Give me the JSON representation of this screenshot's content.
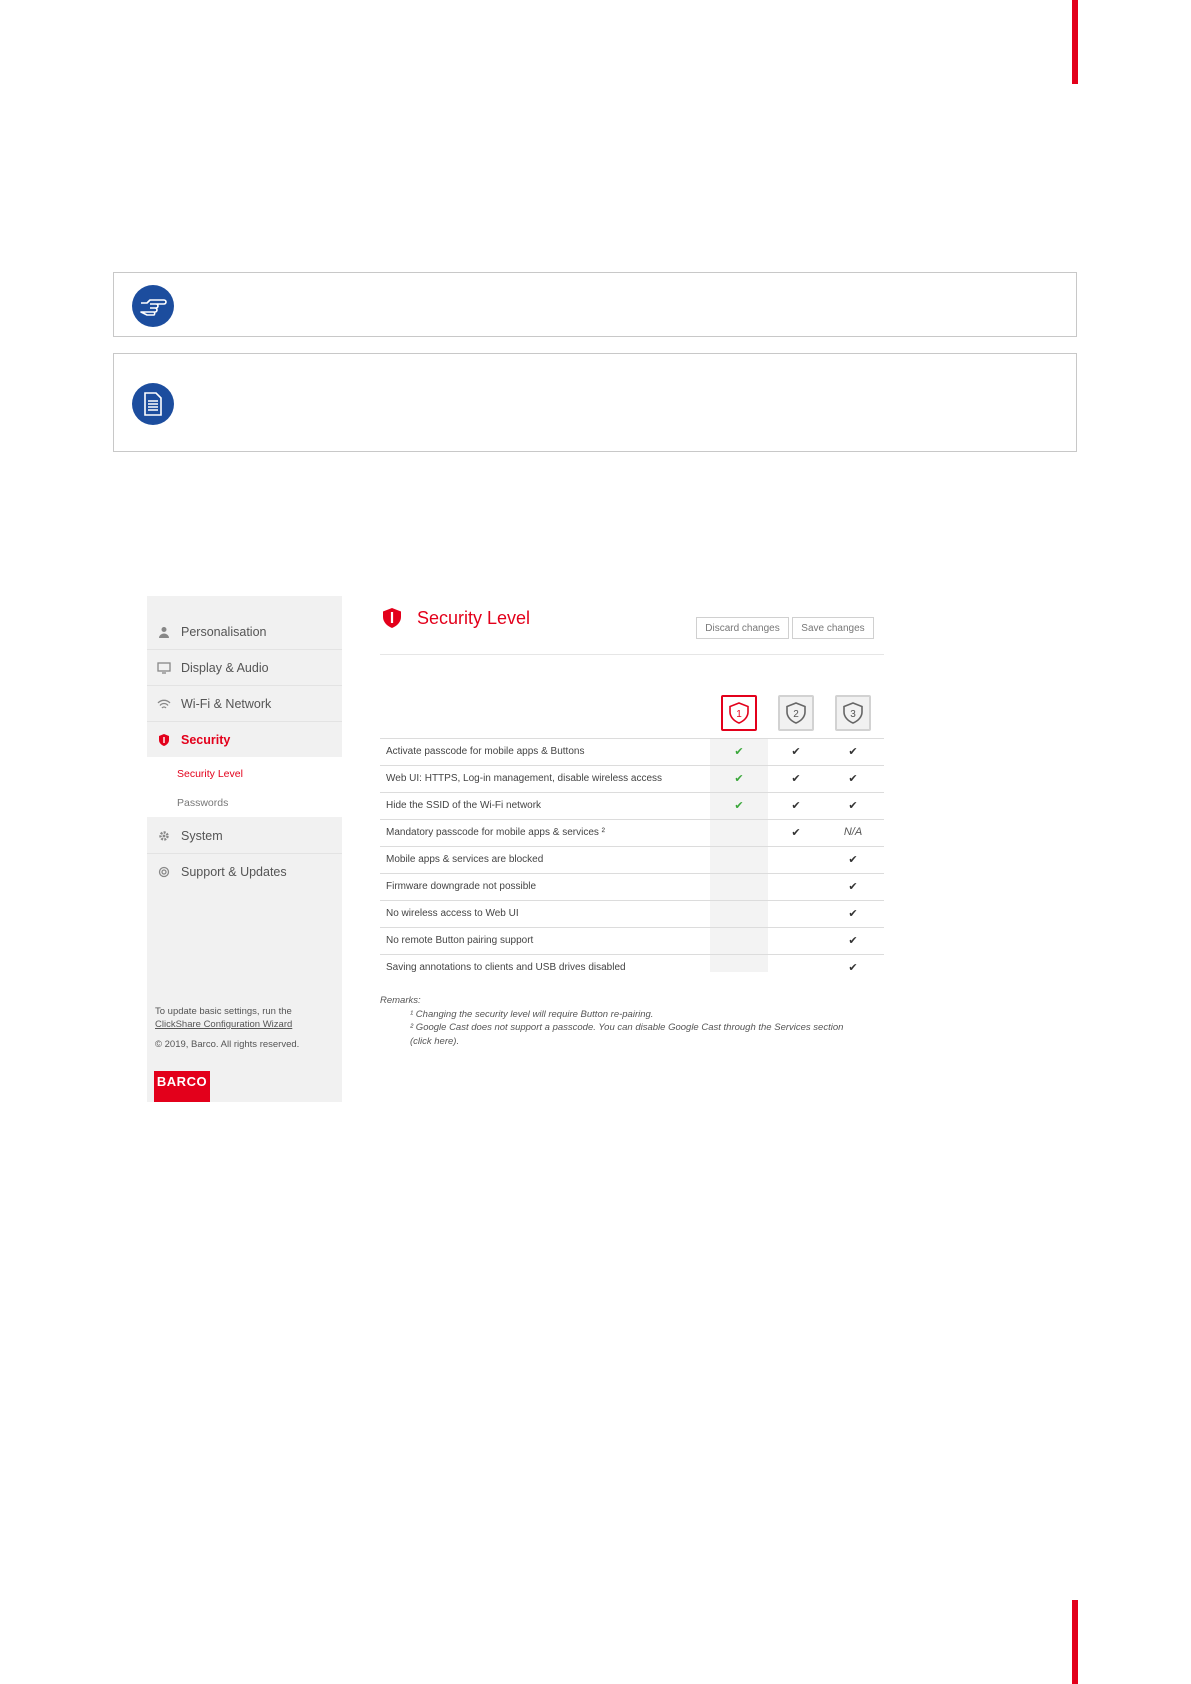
{
  "sidebar": {
    "items": [
      {
        "label": "Personalisation",
        "icon": "user-icon"
      },
      {
        "label": "Display & Audio",
        "icon": "monitor-icon"
      },
      {
        "label": "Wi-Fi & Network",
        "icon": "wifi-icon"
      },
      {
        "label": "Security",
        "icon": "shield-icon"
      },
      {
        "label": "System",
        "icon": "gear-icon"
      },
      {
        "label": "Support & Updates",
        "icon": "lifebuoy-icon"
      }
    ],
    "sub_items": [
      "Security Level",
      "Passwords"
    ],
    "footer_line1": "To update basic settings, run the",
    "footer_link": "ClickShare Configuration Wizard",
    "copyright": "© 2019, Barco. All rights reserved.",
    "logo": "BARCO"
  },
  "main": {
    "title": "Security Level",
    "discard_label": "Discard changes",
    "save_label": "Save changes",
    "levels": [
      "1",
      "2",
      "3"
    ],
    "selected_level": "1",
    "rows": [
      {
        "label": "Activate passcode for mobile apps & Buttons",
        "l1": "✔",
        "l2": "✔",
        "l3": "✔"
      },
      {
        "label": "Web UI: HTTPS, Log-in management, disable wireless access",
        "l1": "✔",
        "l2": "✔",
        "l3": "✔"
      },
      {
        "label": "Hide the SSID of the Wi-Fi network",
        "l1": "✔",
        "l2": "✔",
        "l3": "✔"
      },
      {
        "label": "Mandatory passcode for mobile apps & services ²",
        "l1": "",
        "l2": "✔",
        "l3": "N/A"
      },
      {
        "label": "Mobile apps & services are blocked",
        "l1": "",
        "l2": "",
        "l3": "✔"
      },
      {
        "label": "Firmware downgrade not possible",
        "l1": "",
        "l2": "",
        "l3": "✔"
      },
      {
        "label": "No wireless access to Web UI",
        "l1": "",
        "l2": "",
        "l3": "✔"
      },
      {
        "label": "No remote Button pairing support",
        "l1": "",
        "l2": "",
        "l3": "✔"
      },
      {
        "label": "Saving annotations to clients and USB drives disabled",
        "l1": "",
        "l2": "",
        "l3": "✔"
      }
    ],
    "remarks_title": "Remarks:",
    "remark1": "¹ Changing the security level will require Button re-pairing.",
    "remark2": "² Google Cast does not support a passcode. You can disable Google Cast through the Services section",
    "remark2b": "(click here)."
  },
  "colors": {
    "accent": "#e3001b",
    "icon_blue": "#1c4d9e",
    "check_green": "#3aa73a"
  }
}
